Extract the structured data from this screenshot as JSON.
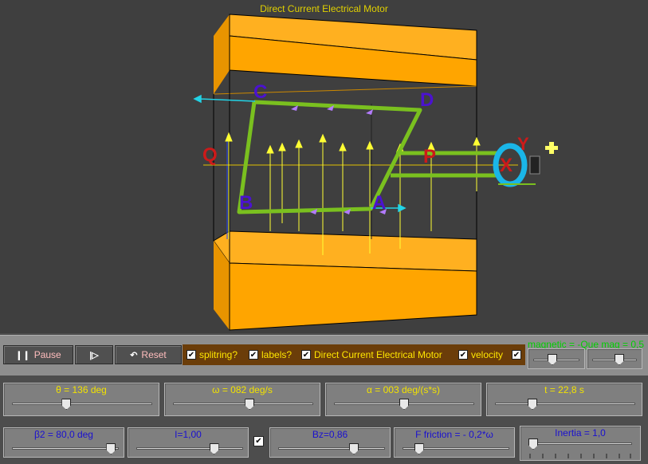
{
  "scene": {
    "title": "Direct Current Electrical Motor",
    "labels": {
      "C": "C",
      "D": "D",
      "B": "B",
      "A": "A",
      "Q": "Q",
      "P": "P",
      "X": "X",
      "Y": "Y"
    }
  },
  "toolbar": {
    "pause_label": "Pause",
    "pause_icon": "pause-icon",
    "step_icon": "step-icon",
    "reset_label": "Reset",
    "reset_icon": "reset-icon",
    "checks": [
      {
        "label": "splitring?",
        "checked": true
      },
      {
        "label": "labels?",
        "checked": true
      },
      {
        "label": "Direct Current Electrical Motor",
        "checked": true
      },
      {
        "label": "velocity",
        "checked": true
      },
      {
        "label": "",
        "checked": true
      }
    ],
    "magnetic_label": "magnetic = -Que mag = 0,5"
  },
  "sliders_row1": [
    {
      "label": "θ = 136 deg",
      "value": 0.38
    },
    {
      "label": "ω = 082 deg/s",
      "value": 0.55
    },
    {
      "label": "α = 003 deg/(s*s)",
      "value": 0.5
    },
    {
      "label": "t = 22,8 s",
      "value": 0.25
    }
  ],
  "sliders_row2": [
    {
      "label": "β2 = 80,0 deg",
      "value": 0.97
    },
    {
      "label": "I=1,00",
      "value": 0.75
    },
    {
      "label": "Bz=0,86",
      "value": 0.73
    },
    {
      "label": "F friction = - 0,2*ω",
      "value": 0.12
    },
    {
      "label": "Inertia = 1,0",
      "value": 0.0
    }
  ],
  "colors": {
    "magnet": "#ffa500",
    "coil": "#7ac01f",
    "field": "#ffff33",
    "label": "#4b12d0",
    "velocity": "#22d3e6",
    "force": "#b37bff"
  }
}
